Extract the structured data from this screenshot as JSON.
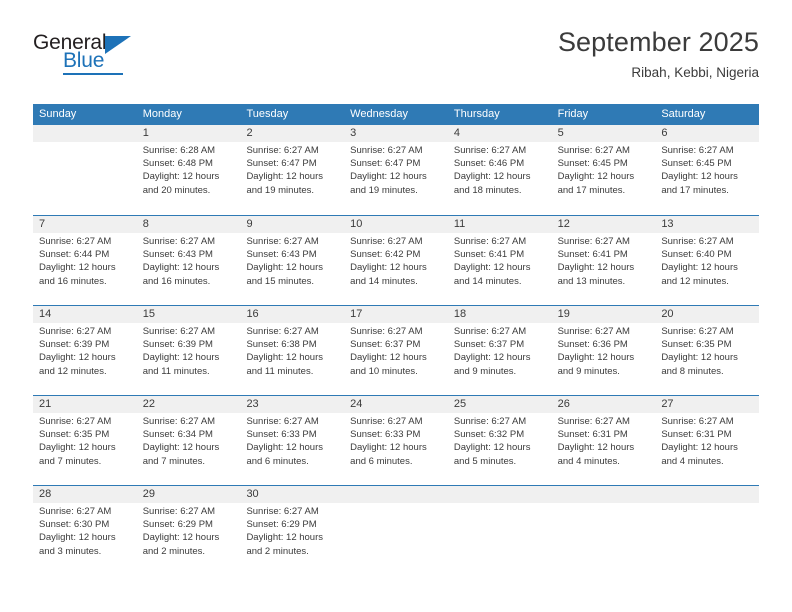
{
  "brand": {
    "name_part1": "General",
    "name_part2": "Blue",
    "accent_color": "#1d72b8"
  },
  "header": {
    "title": "September 2025",
    "subtitle": "Ribah, Kebbi, Nigeria"
  },
  "calendar": {
    "header_bg": "#2f7ab5",
    "weekdays": [
      "Sunday",
      "Monday",
      "Tuesday",
      "Wednesday",
      "Thursday",
      "Friday",
      "Saturday"
    ],
    "weeks": [
      [
        {
          "day": "",
          "lines": []
        },
        {
          "day": "1",
          "lines": [
            "Sunrise: 6:28 AM",
            "Sunset: 6:48 PM",
            "Daylight: 12 hours",
            "and 20 minutes."
          ]
        },
        {
          "day": "2",
          "lines": [
            "Sunrise: 6:27 AM",
            "Sunset: 6:47 PM",
            "Daylight: 12 hours",
            "and 19 minutes."
          ]
        },
        {
          "day": "3",
          "lines": [
            "Sunrise: 6:27 AM",
            "Sunset: 6:47 PM",
            "Daylight: 12 hours",
            "and 19 minutes."
          ]
        },
        {
          "day": "4",
          "lines": [
            "Sunrise: 6:27 AM",
            "Sunset: 6:46 PM",
            "Daylight: 12 hours",
            "and 18 minutes."
          ]
        },
        {
          "day": "5",
          "lines": [
            "Sunrise: 6:27 AM",
            "Sunset: 6:45 PM",
            "Daylight: 12 hours",
            "and 17 minutes."
          ]
        },
        {
          "day": "6",
          "lines": [
            "Sunrise: 6:27 AM",
            "Sunset: 6:45 PM",
            "Daylight: 12 hours",
            "and 17 minutes."
          ]
        }
      ],
      [
        {
          "day": "7",
          "lines": [
            "Sunrise: 6:27 AM",
            "Sunset: 6:44 PM",
            "Daylight: 12 hours",
            "and 16 minutes."
          ]
        },
        {
          "day": "8",
          "lines": [
            "Sunrise: 6:27 AM",
            "Sunset: 6:43 PM",
            "Daylight: 12 hours",
            "and 16 minutes."
          ]
        },
        {
          "day": "9",
          "lines": [
            "Sunrise: 6:27 AM",
            "Sunset: 6:43 PM",
            "Daylight: 12 hours",
            "and 15 minutes."
          ]
        },
        {
          "day": "10",
          "lines": [
            "Sunrise: 6:27 AM",
            "Sunset: 6:42 PM",
            "Daylight: 12 hours",
            "and 14 minutes."
          ]
        },
        {
          "day": "11",
          "lines": [
            "Sunrise: 6:27 AM",
            "Sunset: 6:41 PM",
            "Daylight: 12 hours",
            "and 14 minutes."
          ]
        },
        {
          "day": "12",
          "lines": [
            "Sunrise: 6:27 AM",
            "Sunset: 6:41 PM",
            "Daylight: 12 hours",
            "and 13 minutes."
          ]
        },
        {
          "day": "13",
          "lines": [
            "Sunrise: 6:27 AM",
            "Sunset: 6:40 PM",
            "Daylight: 12 hours",
            "and 12 minutes."
          ]
        }
      ],
      [
        {
          "day": "14",
          "lines": [
            "Sunrise: 6:27 AM",
            "Sunset: 6:39 PM",
            "Daylight: 12 hours",
            "and 12 minutes."
          ]
        },
        {
          "day": "15",
          "lines": [
            "Sunrise: 6:27 AM",
            "Sunset: 6:39 PM",
            "Daylight: 12 hours",
            "and 11 minutes."
          ]
        },
        {
          "day": "16",
          "lines": [
            "Sunrise: 6:27 AM",
            "Sunset: 6:38 PM",
            "Daylight: 12 hours",
            "and 11 minutes."
          ]
        },
        {
          "day": "17",
          "lines": [
            "Sunrise: 6:27 AM",
            "Sunset: 6:37 PM",
            "Daylight: 12 hours",
            "and 10 minutes."
          ]
        },
        {
          "day": "18",
          "lines": [
            "Sunrise: 6:27 AM",
            "Sunset: 6:37 PM",
            "Daylight: 12 hours",
            "and 9 minutes."
          ]
        },
        {
          "day": "19",
          "lines": [
            "Sunrise: 6:27 AM",
            "Sunset: 6:36 PM",
            "Daylight: 12 hours",
            "and 9 minutes."
          ]
        },
        {
          "day": "20",
          "lines": [
            "Sunrise: 6:27 AM",
            "Sunset: 6:35 PM",
            "Daylight: 12 hours",
            "and 8 minutes."
          ]
        }
      ],
      [
        {
          "day": "21",
          "lines": [
            "Sunrise: 6:27 AM",
            "Sunset: 6:35 PM",
            "Daylight: 12 hours",
            "and 7 minutes."
          ]
        },
        {
          "day": "22",
          "lines": [
            "Sunrise: 6:27 AM",
            "Sunset: 6:34 PM",
            "Daylight: 12 hours",
            "and 7 minutes."
          ]
        },
        {
          "day": "23",
          "lines": [
            "Sunrise: 6:27 AM",
            "Sunset: 6:33 PM",
            "Daylight: 12 hours",
            "and 6 minutes."
          ]
        },
        {
          "day": "24",
          "lines": [
            "Sunrise: 6:27 AM",
            "Sunset: 6:33 PM",
            "Daylight: 12 hours",
            "and 6 minutes."
          ]
        },
        {
          "day": "25",
          "lines": [
            "Sunrise: 6:27 AM",
            "Sunset: 6:32 PM",
            "Daylight: 12 hours",
            "and 5 minutes."
          ]
        },
        {
          "day": "26",
          "lines": [
            "Sunrise: 6:27 AM",
            "Sunset: 6:31 PM",
            "Daylight: 12 hours",
            "and 4 minutes."
          ]
        },
        {
          "day": "27",
          "lines": [
            "Sunrise: 6:27 AM",
            "Sunset: 6:31 PM",
            "Daylight: 12 hours",
            "and 4 minutes."
          ]
        }
      ],
      [
        {
          "day": "28",
          "lines": [
            "Sunrise: 6:27 AM",
            "Sunset: 6:30 PM",
            "Daylight: 12 hours",
            "and 3 minutes."
          ]
        },
        {
          "day": "29",
          "lines": [
            "Sunrise: 6:27 AM",
            "Sunset: 6:29 PM",
            "Daylight: 12 hours",
            "and 2 minutes."
          ]
        },
        {
          "day": "30",
          "lines": [
            "Sunrise: 6:27 AM",
            "Sunset: 6:29 PM",
            "Daylight: 12 hours",
            "and 2 minutes."
          ]
        },
        {
          "day": "",
          "lines": []
        },
        {
          "day": "",
          "lines": []
        },
        {
          "day": "",
          "lines": []
        },
        {
          "day": "",
          "lines": []
        }
      ]
    ]
  }
}
